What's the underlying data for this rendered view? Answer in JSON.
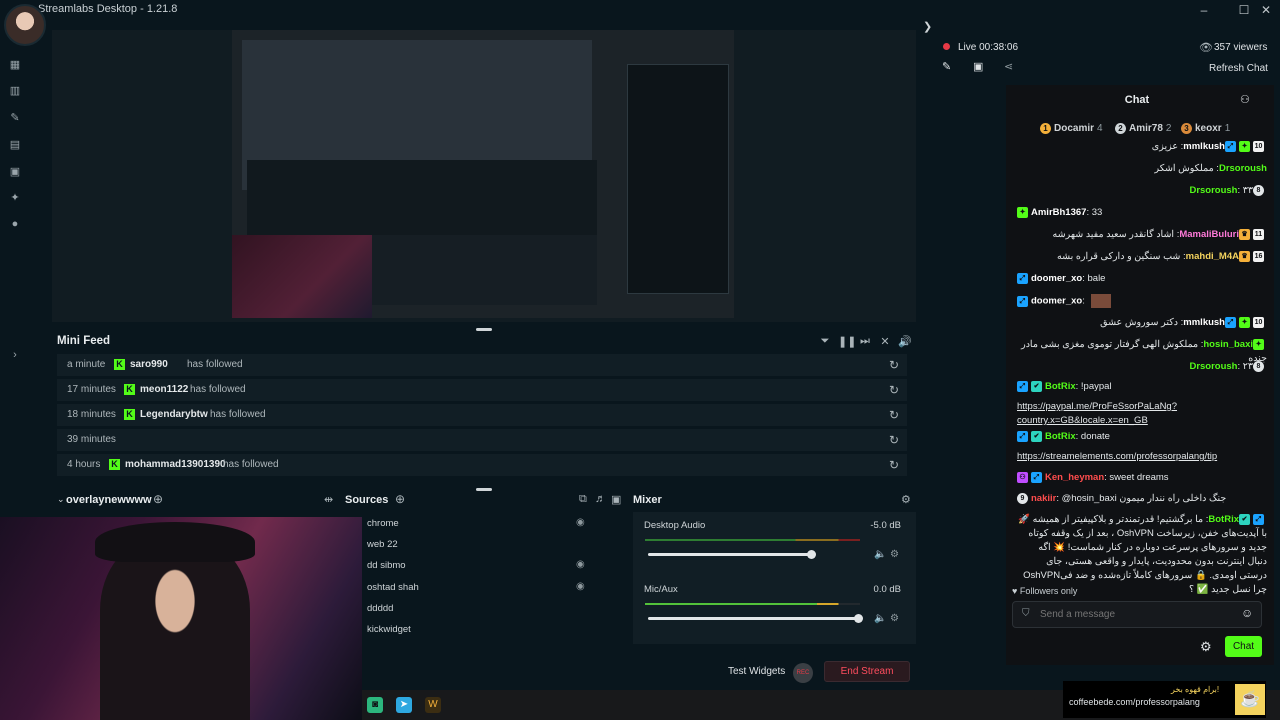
{
  "titlebar": {
    "title": "Streamlabs Desktop - 1.21.8",
    "minimize": "–",
    "maximize": "☐",
    "close": "✕"
  },
  "preview": {
    "collapse_glyph": "❯"
  },
  "minifeed": {
    "title": "Mini Feed",
    "items": [
      {
        "time": "a minute",
        "user": "saro990",
        "action": "has followed"
      },
      {
        "time": "17 minutes",
        "user": "meon1122",
        "action": "has followed"
      },
      {
        "time": "18 minutes",
        "user": "Legendarybtw",
        "action": "has followed"
      },
      {
        "time": "39 minutes",
        "user": "",
        "action": ""
      },
      {
        "time": "4 hours",
        "user": "mohammad13901390",
        "action": "has followed"
      }
    ]
  },
  "scenes": {
    "title": "overlaynewwww"
  },
  "sources": {
    "title": "Sources",
    "items": [
      "chrome",
      "web 22",
      "dd sibmo",
      "oshtad shah",
      "ddddd",
      "kickwidget"
    ]
  },
  "mixer": {
    "title": "Mixer",
    "channels": [
      {
        "name": "Desktop Audio",
        "db": "-5.0 dB",
        "level": 0.9
      },
      {
        "name": "Mic/Aux",
        "db": "0.0 dB",
        "level": 1.0
      }
    ]
  },
  "actions": {
    "test_widgets": "Test Widgets",
    "rec": "REC",
    "end_stream": "End Stream"
  },
  "stream": {
    "live_label": "Live 00:38:06",
    "viewers": "357 viewers",
    "refresh_chat": "Refresh Chat"
  },
  "chat": {
    "title": "Chat",
    "top_chatters": [
      {
        "rank": "1",
        "name": "Docamir",
        "count": "4"
      },
      {
        "rank": "2",
        "name": "Amir78",
        "count": "2"
      },
      {
        "rank": "3",
        "name": "keoxr",
        "count": "1"
      }
    ],
    "messages": [
      {
        "badges": [
          "10",
          "vip",
          "kick"
        ],
        "user": "mmlkush",
        "color": "#ffffff",
        "text": "عزیزی"
      },
      {
        "badges": [],
        "user": "Drsoroush",
        "color": "#53fc18",
        "text": "مملکوش اشکر"
      },
      {
        "badges": [
          "8"
        ],
        "user": "Drsoroush",
        "color": "#53fc18",
        "text": "۳۳"
      },
      {
        "badges": [
          "vip"
        ],
        "user": "AmirBh1367",
        "color": "#ffffff",
        "text": "33"
      },
      {
        "badges": [
          "11",
          "crown"
        ],
        "user": "MamaliBuluri",
        "color": "#ff7ad9",
        "text": "اشاد گانقدر سعید مفید شهرشه"
      },
      {
        "badges": [
          "16",
          "crown"
        ],
        "user": "mahdi_M4A",
        "color": "#f4d35e",
        "text": "شب سنگین و دارکی قراره بشه"
      },
      {
        "badges": [
          "kick"
        ],
        "user": "doomer_xo",
        "color": "#ffffff",
        "text": "bale"
      },
      {
        "badges": [
          "kick"
        ],
        "user": "doomer_xo",
        "color": "#ffffff",
        "text": ""
      },
      {
        "badges": [
          "10",
          "vip",
          "kick"
        ],
        "user": "mmlkush",
        "color": "#ffffff",
        "text": "دکتر سوروش عشق"
      },
      {
        "badges": [
          "vip"
        ],
        "user": "hosin_baxi",
        "color": "#53fc18",
        "text": "مملکوش الهی گرفتار توموی مغزی بشی مادر جنده"
      },
      {
        "badges": [
          "8"
        ],
        "user": "Drsoroush",
        "color": "#53fc18",
        "text": "۲۳"
      },
      {
        "badges": [
          "kick",
          "og"
        ],
        "user": "BotRix",
        "color": "#53fc18",
        "text": "!paypal"
      },
      {
        "badges": [],
        "user": "",
        "color": "#ffffff",
        "text": "https://paypal.me/ProFeSsorPaLaNg?country.x=GB&locale.x=en_GB"
      },
      {
        "badges": [
          "kick",
          "og"
        ],
        "user": "BotRix",
        "color": "#53fc18",
        "text": "donate"
      },
      {
        "badges": [],
        "user": "",
        "color": "#ffffff",
        "text": "https://streamelements.com/professorpalang/tip"
      },
      {
        "badges": [
          "sub",
          "kick"
        ],
        "user": "Ken_heyman",
        "color": "#ff4d4d",
        "text": "sweet dreams"
      },
      {
        "badges": [
          "9"
        ],
        "user": "nakiir",
        "color": "#ff4d4d",
        "text": "@hosin_baxi جنگ داخلی راه نندار میمون"
      },
      {
        "badges": [
          "kick",
          "og"
        ],
        "user": "BotRix",
        "color": "#53fc18",
        "text": "ما برگشتیم! قدرتمندتر و بلاکپیفیتر از همیشه 🚀 با آپدیت‌های خفن، زیرساخت OshVPN ، بعد از یک وقفه کوتاه جدید و سرورهای پرسرعت دوباره در کنار شماست! 💥 اگه دنبال اینترنت بدون محدودیت، پایدار و واقعی هستی، جای درستی اومدی. 🔒 سرورهای کاملاً تازه‌شده و ضد فیOshVPN چرا نسل جدید ✅ ؟"
      }
    ],
    "followers_only": "Followers only",
    "input_placeholder": "Send a message",
    "send_label": "Chat"
  },
  "coffee": {
    "text": "coffeebede.com/professorpalang",
    "subtitle": "برام قهوه بخر!"
  },
  "colors": {
    "kick_green": "#53fc18",
    "end_stream_red": "#e63946",
    "background": "#09161d",
    "chat_bg": "#0f1114"
  }
}
